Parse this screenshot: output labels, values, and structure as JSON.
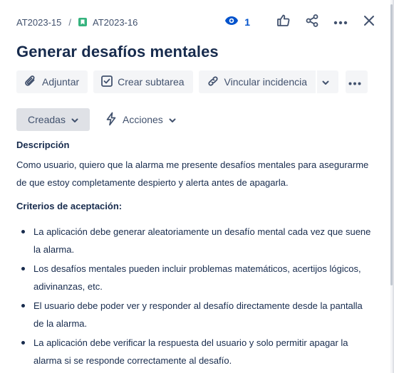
{
  "breadcrumb": {
    "parent_key": "AT2023-15",
    "separator": "/",
    "issue_key": "AT2023-16"
  },
  "header": {
    "watch_count": "1",
    "icons": [
      "eye-icon",
      "thumbs-up-icon",
      "share-icon",
      "more-icon",
      "close-icon"
    ]
  },
  "issue": {
    "title": "Generar desafíos mentales"
  },
  "toolbar": {
    "attach_label": "Adjuntar",
    "subtask_label": "Crear subtarea",
    "link_label": "Vincular incidencia"
  },
  "toolbar2": {
    "created_label": "Creadas",
    "actions_label": "Acciones"
  },
  "description": {
    "label": "Descripción",
    "text": "Como usuario, quiero que la alarma me presente desafíos mentales para asegurarme de que estoy completamente despierto y alerta antes de apagarla.",
    "criteria_title": "Criterios de aceptación:",
    "criteria": [
      "La aplicación debe generar aleatoriamente un desafío mental cada vez que suene la alarma.",
      "Los desafíos mentales pueden incluir problemas matemáticos, acertijos lógicos, adivinanzas, etc.",
      "El usuario debe poder ver y responder al desafío directamente desde la pantalla de la alarma.",
      "La aplicación debe verificar la respuesta del usuario y solo permitir apagar la alarma si se responde correctamente al desafío."
    ]
  },
  "colors": {
    "accent": "#0052cc",
    "story_green": "#36b37e",
    "text": "#172b4d",
    "subtle": "#42526e",
    "button_bg": "#f4f5f7",
    "selected_bg": "#dfe1e6"
  }
}
